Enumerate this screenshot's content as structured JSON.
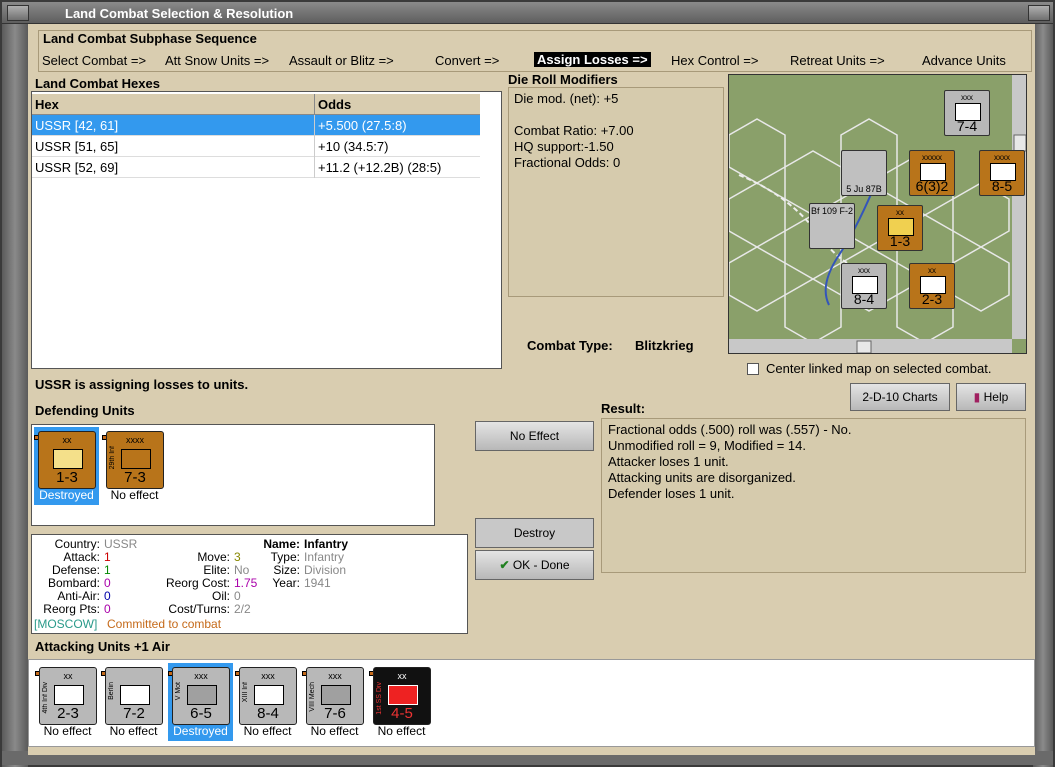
{
  "window": {
    "title": "Land Combat Selection & Resolution"
  },
  "subphase": {
    "title": "Land Combat Subphase Sequence",
    "steps": [
      "Select Combat =>",
      "Att Snow Units =>",
      "Assault or Blitz =>",
      "Convert =>",
      "Assign Losses =>",
      "Hex Control =>",
      "Retreat Units =>",
      "Advance Units"
    ],
    "active_step": "Assign Losses =>"
  },
  "hexes": {
    "title": "Land Combat Hexes",
    "columns": [
      "Hex",
      "Odds"
    ],
    "rows": [
      {
        "hex": "USSR [42, 61]",
        "odds": "+5.500 (27.5:8)"
      },
      {
        "hex": "USSR [51, 65]",
        "odds": "+10 (34.5:7)"
      },
      {
        "hex": "USSR [52, 69]",
        "odds": "+11.2 (+12.2B) (28:5)"
      }
    ]
  },
  "die_roll": {
    "title": "Die Roll Modifiers",
    "net": "Die mod. (net): +5",
    "ratio": "Combat Ratio: +7.00",
    "hq": "HQ support:-1.50",
    "fractional": "Fractional Odds: 0"
  },
  "combat_type": {
    "label": "Combat Type:",
    "value": "Blitzkrieg"
  },
  "center_map": {
    "label": "Center linked map on selected combat."
  },
  "status_msg": "USSR is assigning losses to units.",
  "defending": {
    "title": "Defending Units",
    "units": [
      {
        "size": "xx",
        "value": "1-3",
        "side": "",
        "caption": "Destroyed"
      },
      {
        "size": "xxxx",
        "value": "7-3",
        "side": "29th Inf",
        "caption": "No effect"
      }
    ]
  },
  "buttons": {
    "charts": "2-D-10 Charts",
    "help": "Help",
    "no_effect": "No Effect",
    "destroy": "Destroy",
    "ok": "OK - Done"
  },
  "result": {
    "title": "Result:",
    "lines": [
      "Fractional odds (.500) roll was (.557)  - No.",
      "Unmodified roll = 9, Modified = 14.",
      "Attacker loses 1 unit.",
      "Attacking units are disorganized.",
      "Defender loses 1 unit."
    ]
  },
  "unit_info": {
    "country_label": "Country:",
    "country": "USSR",
    "attack_label": "Attack:",
    "attack": "1",
    "defense_label": "Defense:",
    "defense": "1",
    "bombard_label": "Bombard:",
    "bombard": "0",
    "antiair_label": "Anti-Air:",
    "antiair": "0",
    "reorgpts_label": "Reorg Pts:",
    "reorgpts": "0",
    "move_label": "Move:",
    "move": "3",
    "elite_label": "Elite:",
    "elite": "No",
    "reorgcost_label": "Reorg Cost:",
    "reorgcost": "1.75",
    "oil_label": "Oil:",
    "oil": "0",
    "costturns_label": "Cost/Turns:",
    "costturns": "2/2",
    "name_label": "Name:",
    "name": "Infantry",
    "type_label": "Type:",
    "type": "Infantry",
    "size_label": "Size:",
    "size": "Division",
    "year_label": "Year:",
    "year": "1941",
    "location": "[MOSCOW]",
    "committed": "Committed to combat"
  },
  "attacking": {
    "title": "Attacking Units +1 Air",
    "units": [
      {
        "size": "xx",
        "value": "2-3",
        "side": "4th Inf Div",
        "caption": "No effect"
      },
      {
        "size": "",
        "value": "7-2",
        "side": "Berlin",
        "caption": "No effect"
      },
      {
        "size": "xxx",
        "value": "6-5",
        "side": "V Mot",
        "caption": "Destroyed"
      },
      {
        "size": "xxx",
        "value": "8-4",
        "side": "XIII Inf",
        "caption": "No effect"
      },
      {
        "size": "xxx",
        "value": "7-6",
        "side": "VIII Mech",
        "caption": "No effect"
      },
      {
        "size": "xx",
        "value": "4-5",
        "side": "1st SS Div",
        "caption": "No effect"
      }
    ]
  },
  "map": {
    "counters": [
      "7-4",
      "6(3)2",
      "8-5",
      "1-3",
      "8-4",
      "2-3",
      "5 Ju 87B",
      "Bf 109 F-2"
    ]
  },
  "colors": {
    "tan": "#d9cdb0",
    "german_gray": "#b8b8b8",
    "soviet_orange": "#b8741a",
    "select_blue": "#3399ee",
    "ss_black": "#111111"
  }
}
